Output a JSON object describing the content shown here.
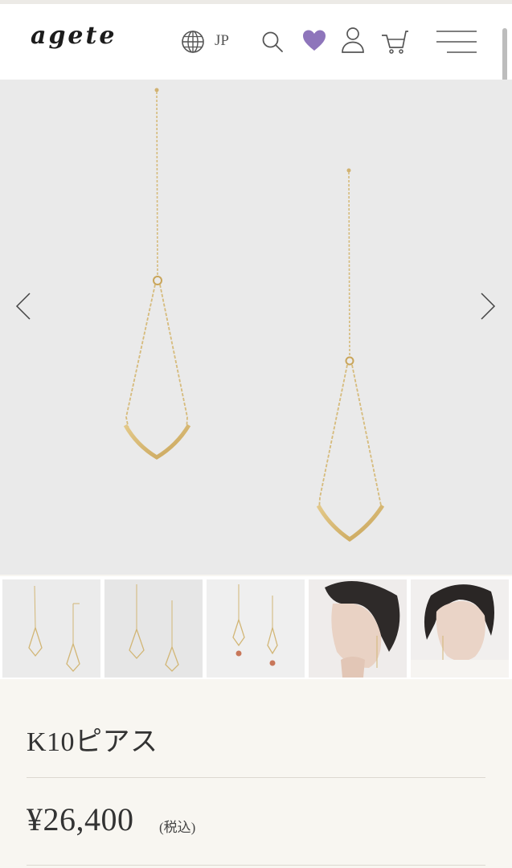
{
  "header": {
    "logo_text": "agete",
    "language": "JP",
    "icons": [
      "globe-icon",
      "search-icon",
      "heart-icon",
      "account-icon",
      "cart-icon",
      "menu-icon"
    ],
    "accent_color": "#8e75bb"
  },
  "gallery": {
    "prev_icon": "chevron-left-icon",
    "next_icon": "chevron-right-icon",
    "thumbnails": [
      {
        "name": "thumb-earrings-pair-1"
      },
      {
        "name": "thumb-earrings-pair-2"
      },
      {
        "name": "thumb-earrings-stone"
      },
      {
        "name": "thumb-model-profile"
      },
      {
        "name": "thumb-model-front"
      }
    ]
  },
  "product": {
    "name": "K10ピアス",
    "price": "¥26,400",
    "tax_note": "(税込)"
  }
}
